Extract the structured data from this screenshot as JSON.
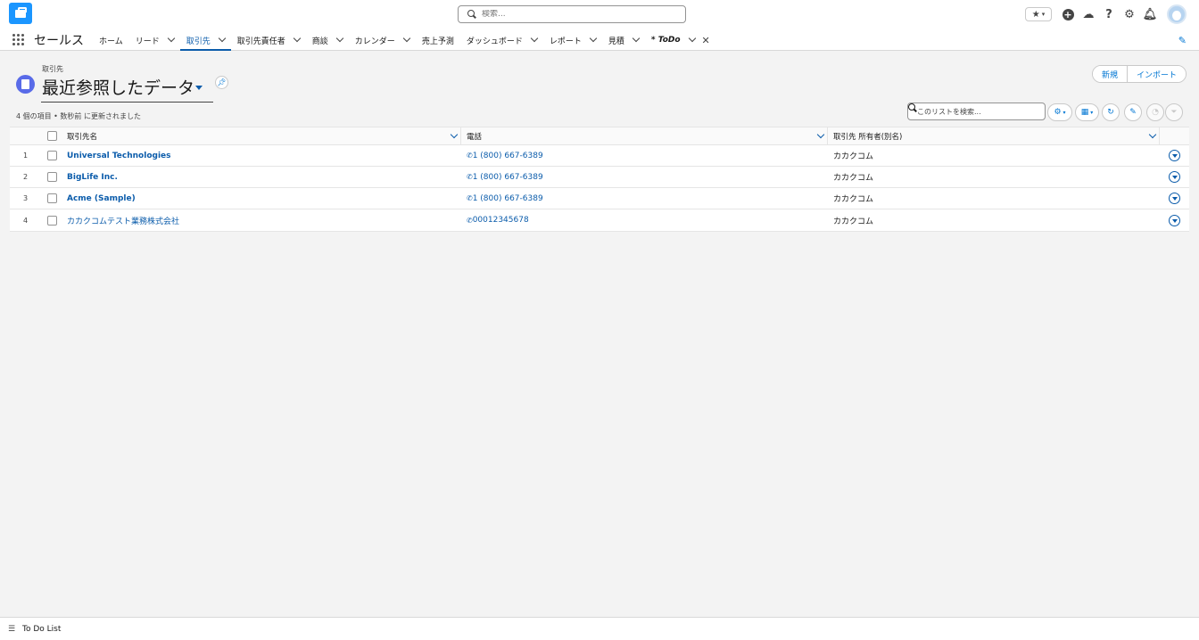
{
  "header": {
    "search_placeholder": "検索..."
  },
  "nav": {
    "app_name": "セールス",
    "items": [
      {
        "label": "ホーム",
        "chevron": false
      },
      {
        "label": "リード",
        "chevron": true
      },
      {
        "label": "取引先",
        "chevron": true,
        "active": true
      },
      {
        "label": "取引先責任者",
        "chevron": true
      },
      {
        "label": "商談",
        "chevron": true
      },
      {
        "label": "カレンダー",
        "chevron": true
      },
      {
        "label": "売上予測",
        "chevron": false
      },
      {
        "label": "ダッシュボード",
        "chevron": true
      },
      {
        "label": "レポート",
        "chevron": true
      },
      {
        "label": "見積",
        "chevron": true
      },
      {
        "label": "* ToDo",
        "chevron": true,
        "closable": true
      }
    ]
  },
  "list_view": {
    "object_label": "取引先",
    "title": "最近参照したデータ",
    "info": "4 個の項目 • 数秒前 に更新されました",
    "buttons": {
      "new": "新規",
      "import": "インポート"
    },
    "search_placeholder": "このリストを検索..."
  },
  "table": {
    "columns": {
      "name": "取引先名",
      "phone": "電話",
      "owner": "取引先 所有者(別名)"
    },
    "rows": [
      {
        "num": "1",
        "name": "Universal Technologies",
        "phone": "1 (800) 667-6389",
        "owner": "カカクコム"
      },
      {
        "num": "2",
        "name": "BigLife Inc.",
        "phone": "1 (800) 667-6389",
        "owner": "カカクコム"
      },
      {
        "num": "3",
        "name": "Acme (Sample)",
        "phone": "1 (800) 667-6389",
        "owner": "カカクコム"
      },
      {
        "num": "4",
        "name": "カカクコムテスト業務株式会社",
        "phone": "00012345678",
        "owner": "カカクコム"
      }
    ]
  },
  "utility_bar": {
    "label": "To Do List"
  },
  "colors": {
    "brand": "#0176d3",
    "link": "#0b5cab",
    "object_icon": "#596be8",
    "app_logo": "#1b96ff"
  }
}
